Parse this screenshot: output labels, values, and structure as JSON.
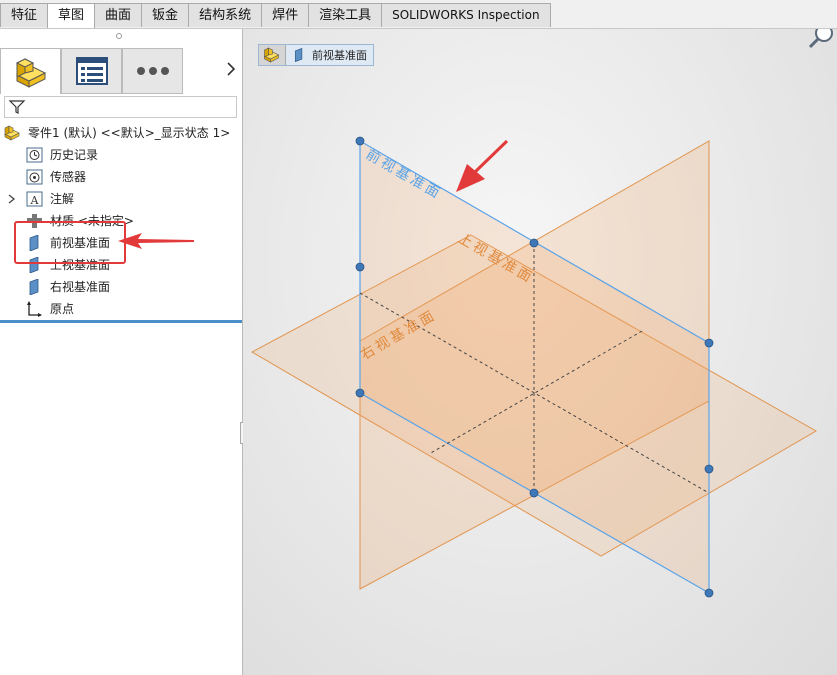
{
  "ribbon": {
    "tabs": [
      {
        "label": "特征",
        "active": false
      },
      {
        "label": "草图",
        "active": true
      },
      {
        "label": "曲面",
        "active": false
      },
      {
        "label": "钣金",
        "active": false
      },
      {
        "label": "结构系统",
        "active": false
      },
      {
        "label": "焊件",
        "active": false
      },
      {
        "label": "渲染工具",
        "active": false
      },
      {
        "label": "SOLIDWORKS Inspection",
        "active": false
      }
    ]
  },
  "feature_tree": {
    "filter_placeholder": "",
    "part_name": "零件1 (默认) <<默认>_显示状态 1>",
    "items": [
      {
        "label": "历史记录",
        "icon": "history-icon"
      },
      {
        "label": "传感器",
        "icon": "sensor-icon"
      },
      {
        "label": "注解",
        "icon": "annotation-icon",
        "expandable": true
      },
      {
        "label": "材质 <未指定>",
        "icon": "material-icon"
      },
      {
        "label": "前视基准面",
        "icon": "plane-icon",
        "selected": true
      },
      {
        "label": "上视基准面",
        "icon": "plane-icon"
      },
      {
        "label": "右视基准面",
        "icon": "plane-icon"
      },
      {
        "label": "原点",
        "icon": "origin-icon"
      }
    ]
  },
  "breadcrumb": {
    "items": [
      "前视基准面"
    ]
  },
  "viewport": {
    "plane_labels": {
      "front": "前视基准面",
      "top": "上视基准面",
      "right": "右视基准面"
    }
  },
  "colors": {
    "selection_blue": "#5aa3e8",
    "plane_orange": "#e8a060",
    "annotation_red": "#e23a3a",
    "panel_accent": "#4a8fc9"
  }
}
